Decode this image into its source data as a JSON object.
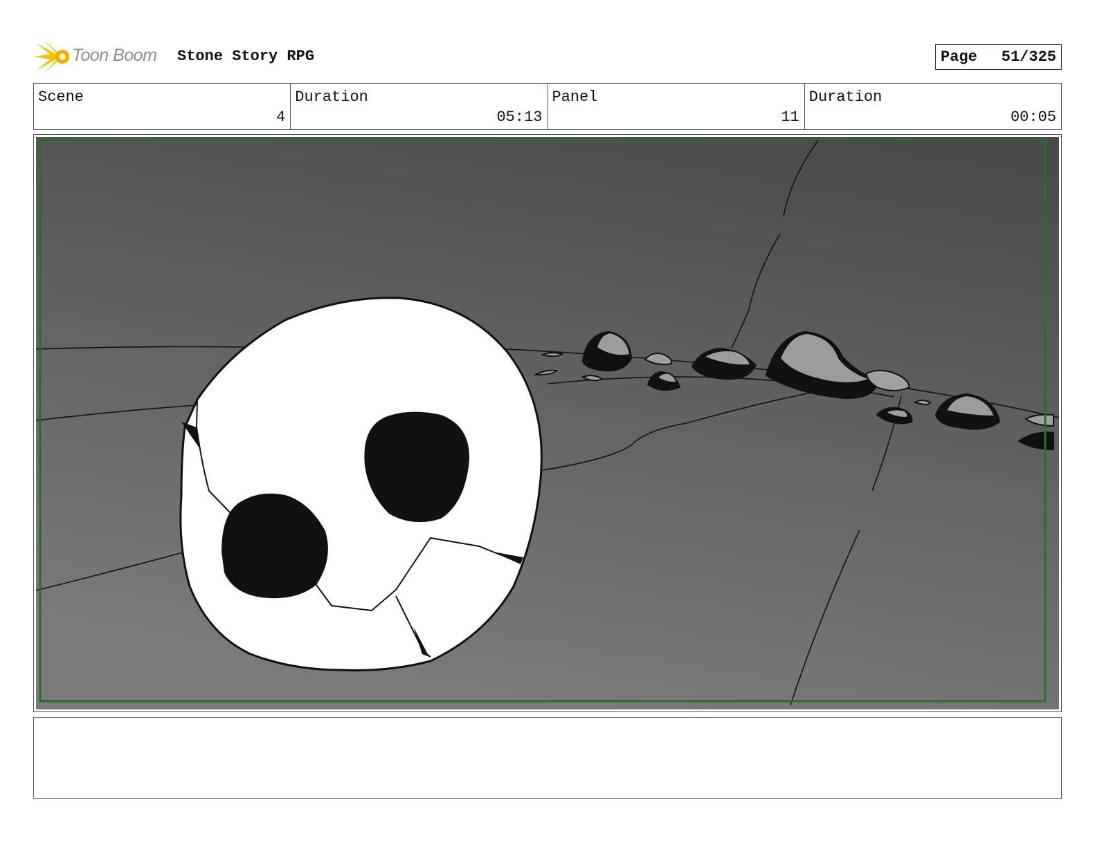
{
  "header": {
    "brand": "Toon Boom",
    "project_title": "Stone Story RPG",
    "page_label": "Page",
    "page_value": "51/325"
  },
  "info": [
    {
      "label": "Scene",
      "value": "4"
    },
    {
      "label": "Duration",
      "value": "05:13"
    },
    {
      "label": "Panel",
      "value": "11"
    },
    {
      "label": "Duration",
      "value": "00:05"
    }
  ],
  "panel": {
    "frame_color": "#2d6b2d",
    "background_top": "#4a4a4a",
    "background_bottom": "#7a7a7a"
  },
  "notes": ""
}
